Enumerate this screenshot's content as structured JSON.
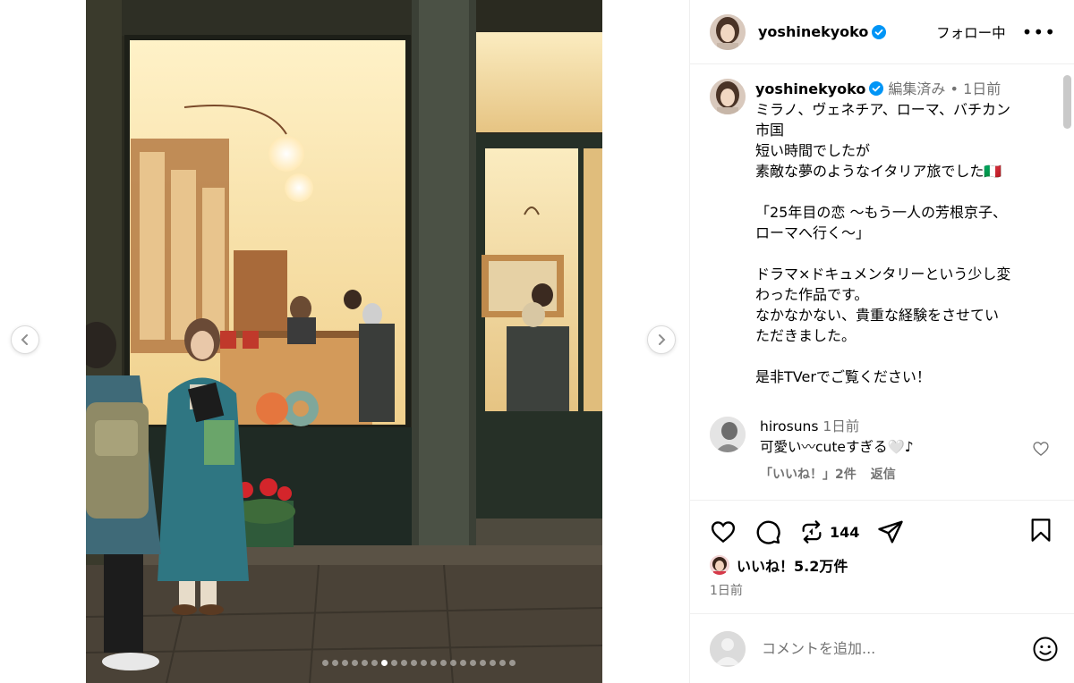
{
  "post": {
    "username": "yoshinekyoko",
    "follow_label": "フォロー中",
    "more_label": "•••",
    "photo_alt": "Photo carousel slide",
    "carousel": {
      "total": 20,
      "active_index": 6
    }
  },
  "caption": {
    "username": "yoshinekyoko",
    "edited": "編集済み",
    "separator": "•",
    "age": "1日前",
    "text": "ミラノ、ヴェネチア、ローマ、バチカン\n市国\n短い時間でしたが\n素敵な夢のようなイタリア旅でした🇮🇹\n\n「25年目の恋 〜もう一人の芳根京子、\nローマへ行く〜」\n\nドラマ×ドキュメンタリーという少し変\nわった作品です。\nなかなかない、貴重な経験をさせてい\nただきました。\n\n是非TVerでご覧ください！"
  },
  "comment": {
    "username": "hirosuns",
    "age": "1日前",
    "text": "可愛い〰︎cuteすぎる🤍♪",
    "likes_label": "「いいね！」2件",
    "reply_label": "返信"
  },
  "actions": {
    "repost_count": "144"
  },
  "likes": {
    "label": "いいね！5.2万件"
  },
  "timestamp": "1日前",
  "add_comment": {
    "placeholder": "コメントを追加..."
  },
  "colors": {
    "verified": "#0095f6",
    "muted": "#737373",
    "border": "#efefef"
  }
}
